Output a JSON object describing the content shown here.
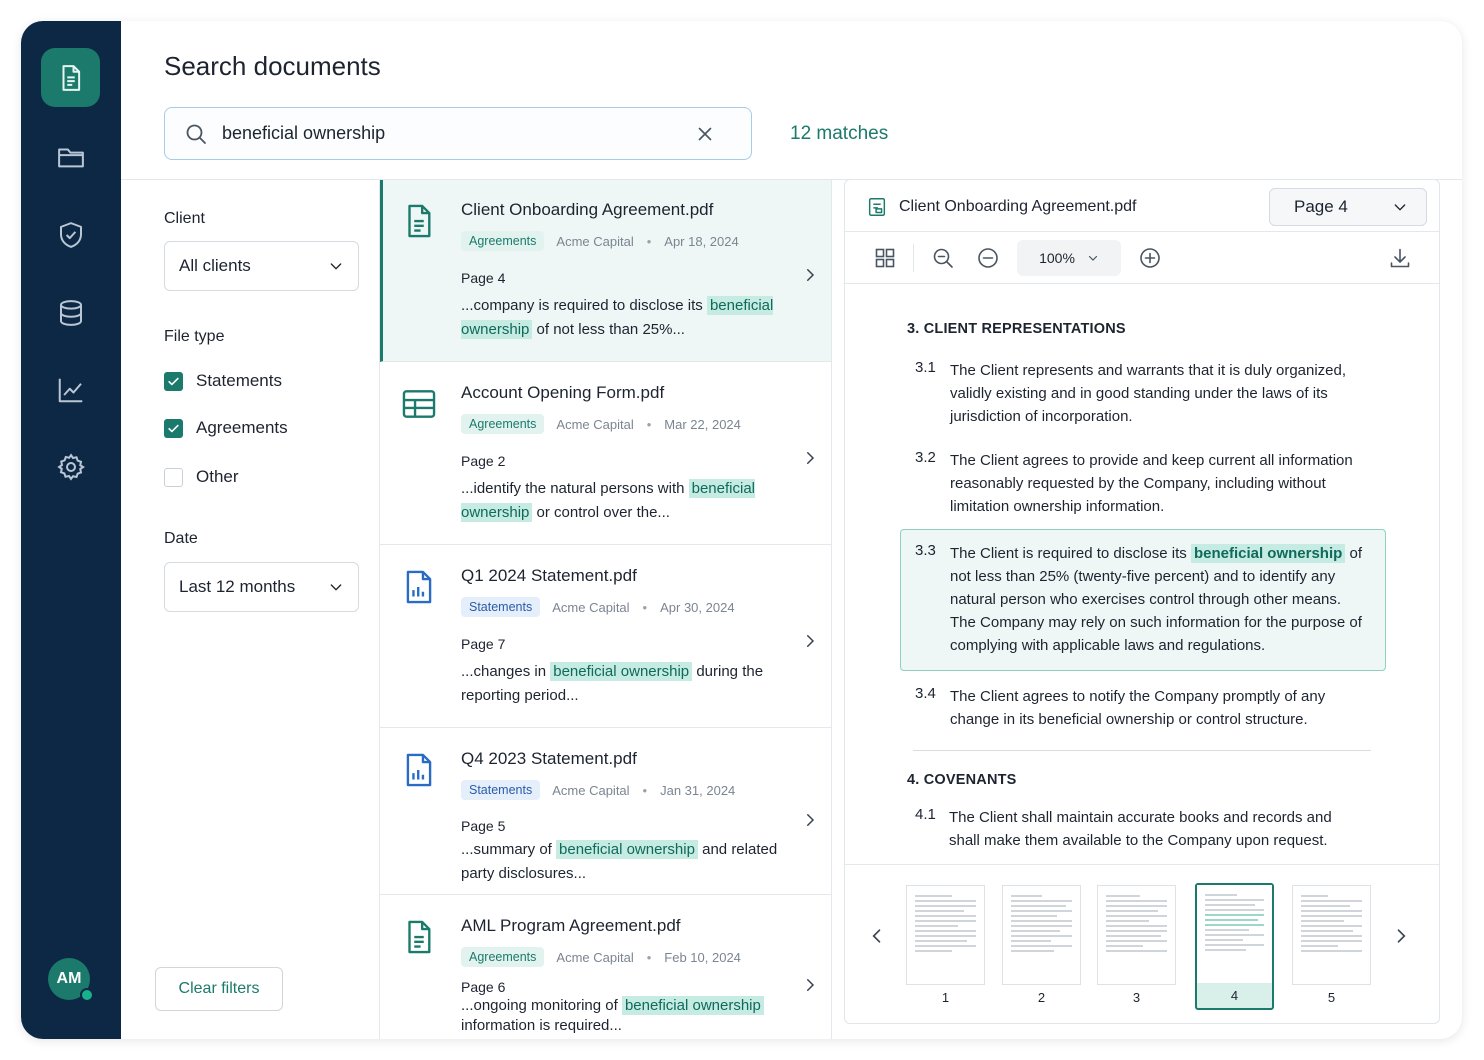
{
  "sidebar": {
    "items": [
      {
        "icon": "document-icon",
        "active": true
      },
      {
        "icon": "folder-icon",
        "active": false
      },
      {
        "icon": "shield-check-icon",
        "active": false
      },
      {
        "icon": "database-icon",
        "active": false
      },
      {
        "icon": "chart-line-icon",
        "active": false
      },
      {
        "icon": "gear-icon",
        "active": false
      }
    ],
    "avatar_initials": "AM",
    "colors": {
      "background": "#0d2844",
      "accent": "#1b7a6b",
      "online": "#19b08a"
    }
  },
  "header": {
    "title": "Search documents",
    "search_value": "beneficial ownership",
    "matches_label": "12 matches"
  },
  "filters": {
    "client_label": "Client",
    "client_value": "All clients",
    "file_type_label": "File type",
    "file_types": [
      {
        "label": "Statements",
        "checked": true
      },
      {
        "label": "Agreements",
        "checked": true
      },
      {
        "label": "Other",
        "checked": false
      }
    ],
    "date_label": "Date",
    "date_value": "Last 12 months",
    "clear_label": "Clear filters"
  },
  "results": [
    {
      "title": "Client Onboarding Agreement.pdf",
      "tag": "Agreements",
      "client": "Acme Capital",
      "date": "Apr 18, 2024",
      "page": "Page 4",
      "before": "...company is required to disclose its ",
      "highlight": "beneficial ownership",
      "after": " of not less than 25%...",
      "icon": "document-icon"
    },
    {
      "title": "Account Opening Form.pdf",
      "tag": "Agreements",
      "client": "Acme Capital",
      "date": "Mar 22, 2024",
      "page": "Page 2",
      "before": "...identify the natural persons with ",
      "highlight": "beneficial ownership",
      "after": " or control over the...",
      "icon": "table-icon"
    },
    {
      "title": "Q1 2024 Statement.pdf",
      "tag": "Statements",
      "client": "Acme Capital",
      "date": "Apr 30, 2024",
      "page": "Page 7",
      "before": "...changes in ",
      "highlight": "beneficial ownership",
      "after": " during the reporting period...",
      "icon": "bar-chart-icon"
    },
    {
      "title": "Q4 2023 Statement.pdf",
      "tag": "Statements",
      "client": "Acme Capital",
      "date": "Jan 31, 2024",
      "page": "Page 5",
      "before": "...summary of ",
      "highlight": "beneficial ownership",
      "after": " and related party disclosures...",
      "icon": "bar-chart-icon"
    },
    {
      "title": "AML Program Agreement.pdf",
      "tag": "Agreements",
      "client": "Acme Capital",
      "date": "Feb 10, 2024",
      "page": "Page 6",
      "before": "...ongoing monitoring of ",
      "highlight": "beneficial ownership",
      "after": " information is required...",
      "icon": "document-icon"
    }
  ],
  "viewer": {
    "file_title": "Client Onboarding Agreement.pdf",
    "page_select": "Page 4",
    "zoom": "100%",
    "section3_heading": "3.   CLIENT REPRESENTATIONS",
    "clauses": [
      {
        "num": "3.1",
        "text": "The Client represents and warrants that it is duly organized, validly existing and in good standing under the laws of its jurisdiction of incorporation."
      },
      {
        "num": "3.2",
        "text": "The Client agrees to provide and keep current all information reasonably requested by the Company, including without limitation ownership information."
      },
      {
        "num": "3.3",
        "before": "The Client is required to disclose its ",
        "highlight": "beneficial ownership",
        "after": " of not less than 25% (twenty-five percent) and to identify any natural person who exercises control through other means. The Company may rely on such information for the purpose of complying with applicable laws and regulations."
      },
      {
        "num": "3.4",
        "text": "The Client agrees to notify the Company promptly of any change in its beneficial ownership or control structure."
      }
    ],
    "section4_heading": "4.   COVENANTS",
    "clause41": {
      "num": "4.1",
      "text": "The Client shall maintain accurate books and records and shall make them available to the Company upon request."
    },
    "thumbnails": [
      "1",
      "2",
      "3",
      "4",
      "5"
    ],
    "active_thumbnail": "4"
  }
}
